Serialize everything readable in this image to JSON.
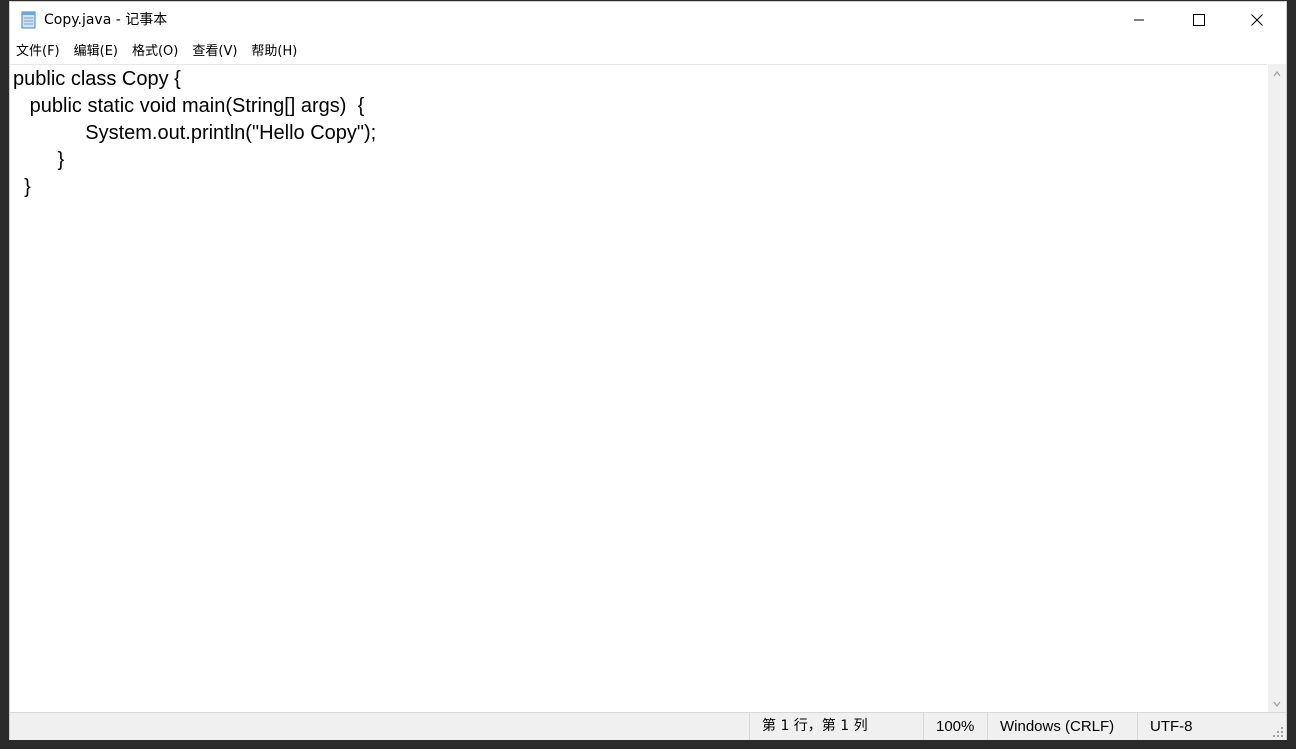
{
  "window": {
    "title": "Copy.java - 记事本"
  },
  "menu": {
    "items": [
      {
        "label": "文件(F)"
      },
      {
        "label": "编辑(E)"
      },
      {
        "label": "格式(O)"
      },
      {
        "label": "查看(V)"
      },
      {
        "label": "帮助(H)"
      }
    ]
  },
  "editor": {
    "lines": [
      "public class Copy {",
      "   public static void main(String[] args)  {",
      "             System.out.println(\"Hello Copy\");",
      "        }",
      "  }"
    ]
  },
  "status": {
    "position": "第 1 行，第 1 列",
    "zoom": "100%",
    "line_ending": "Windows (CRLF)",
    "encoding": "UTF-8"
  },
  "icons": {
    "app": "notepad-icon",
    "minimize": "minimize-icon",
    "maximize": "maximize-icon",
    "close": "close-icon"
  }
}
